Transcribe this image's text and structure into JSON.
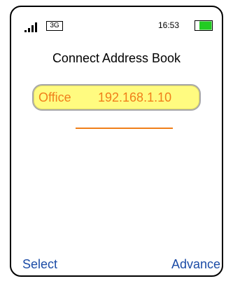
{
  "status_bar": {
    "signal_icon": "signal-bars-icon",
    "network": "3G",
    "time": "16:53",
    "battery_icon": "battery-icon",
    "battery_color": "#22cc22"
  },
  "title": "Connect Address Book",
  "entry": {
    "name": "Office",
    "ip": "192.168.1.10",
    "highlight_color": "#fffb80",
    "text_color": "#f07f1a"
  },
  "softkeys": {
    "left": "Select",
    "right": "Advance",
    "color": "#1b4ba6"
  }
}
